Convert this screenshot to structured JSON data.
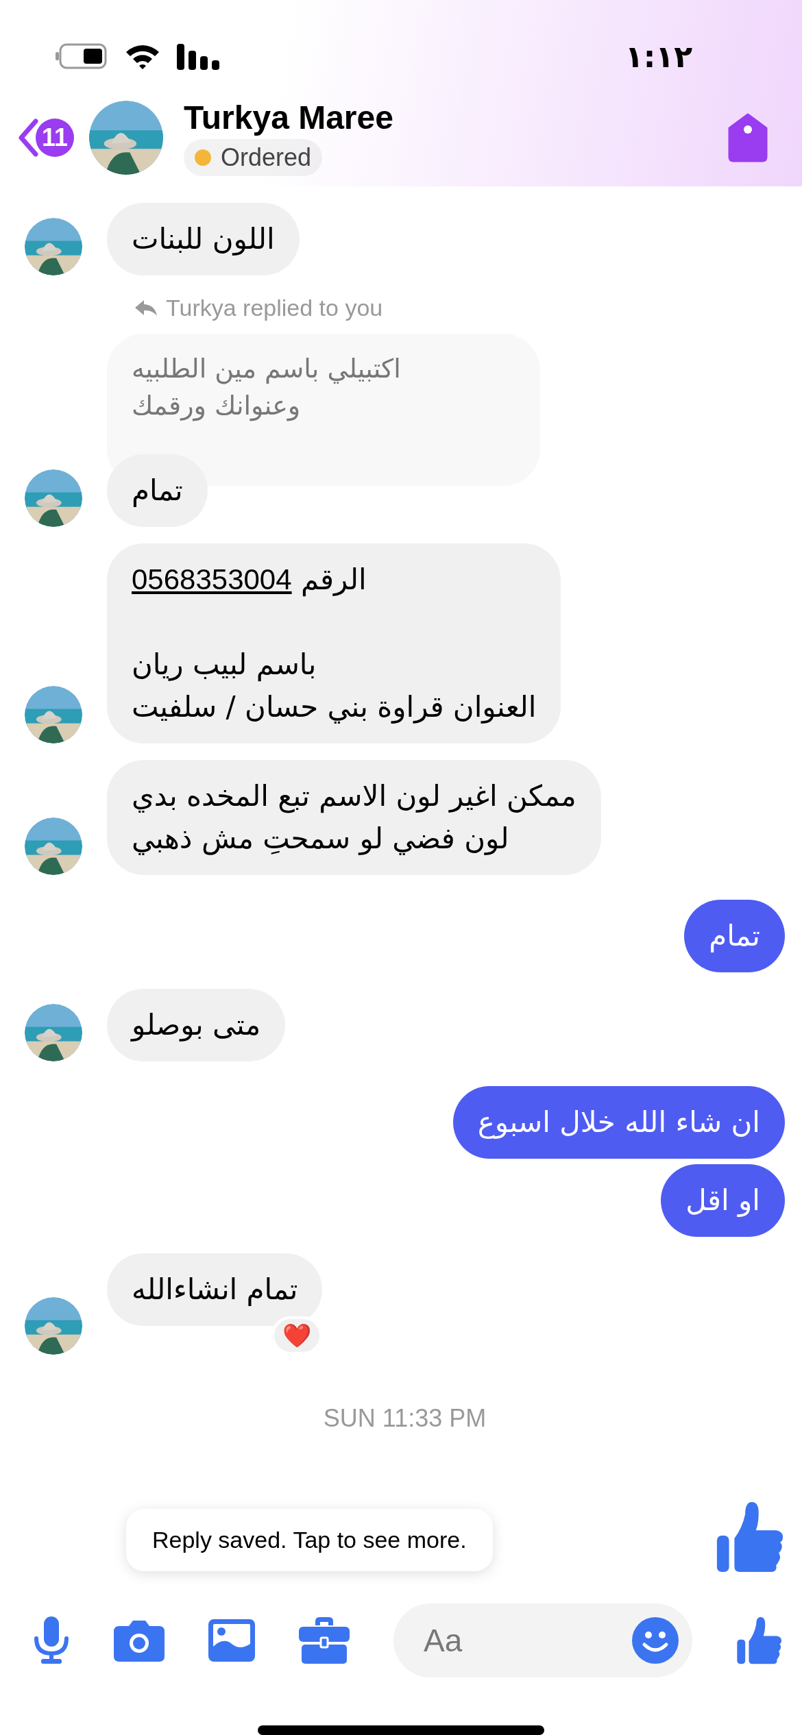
{
  "status_bar": {
    "time": "١:١٢"
  },
  "header": {
    "back_badge": "11",
    "name": "Turkya Maree",
    "status": {
      "label": "Ordered",
      "color": "#f4b63a"
    }
  },
  "messages": [
    {
      "kind": "incoming",
      "text": "اللون للبنات"
    },
    {
      "kind": "reply",
      "label": "Turkya replied to you",
      "quoted": "اكتبيلي باسم مين الطلبيه\nوعنوانك ورقمك"
    },
    {
      "kind": "incoming",
      "text": "تمام"
    },
    {
      "kind": "contact",
      "phone": "0568353004",
      "phone_label": "الرقم",
      "text": "باسم لبيب ريان\nالعنوان قراوة بني حسان / سلفيت"
    },
    {
      "kind": "incoming",
      "text": "ممكن اغير لون الاسم تبع المخده بدي\nلون فضي لو سمحتِ مش ذهبي"
    },
    {
      "kind": "outgoing",
      "text": "تمام"
    },
    {
      "kind": "incoming",
      "text": "متى بوصلو"
    },
    {
      "kind": "outgoing",
      "text": "ان شاء الله خلال اسبوع"
    },
    {
      "kind": "outgoing",
      "text": "او اقل"
    },
    {
      "kind": "incoming",
      "text": "تمام انشاءالله",
      "reaction": "❤️"
    },
    {
      "kind": "timestamp",
      "text": "SUN 11:33 PM"
    }
  ],
  "tooltip": "Reply saved. Tap to see more.",
  "composer": {
    "placeholder": "Aa"
  }
}
